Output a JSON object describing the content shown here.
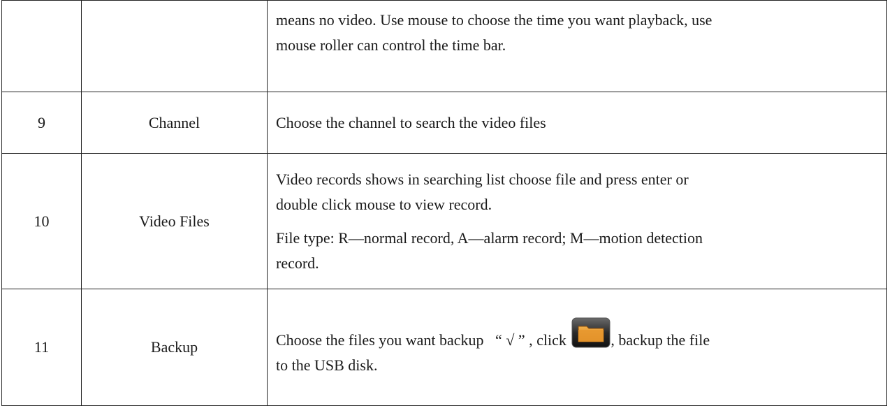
{
  "table": {
    "rows": [
      {
        "number": "",
        "name": "",
        "lines": [
          "means no video. Use mouse to choose the time you want playback, use",
          "mouse roller can control the time bar."
        ]
      },
      {
        "number": "9",
        "name": "Channel",
        "lines": [
          "Choose the channel to search the video files"
        ]
      },
      {
        "number": "10",
        "name": "Video Files",
        "para1": [
          "Video records shows in searching list choose file and press enter or",
          "double click mouse to view record."
        ],
        "para2": [
          "File type: R—normal record, A—alarm record; M—motion detection",
          "record."
        ]
      },
      {
        "number": "11",
        "name": "Backup",
        "line1_before_icon": "Choose the files you want backup   “ √ ” , click ",
        "line1_after_icon": ", backup the file",
        "line2": "to the USB disk.",
        "icon": "folder-icon"
      }
    ]
  },
  "colors": {
    "border": "#222222",
    "icon_folder": "#e0922a",
    "icon_frame": "#2b2b2b"
  }
}
